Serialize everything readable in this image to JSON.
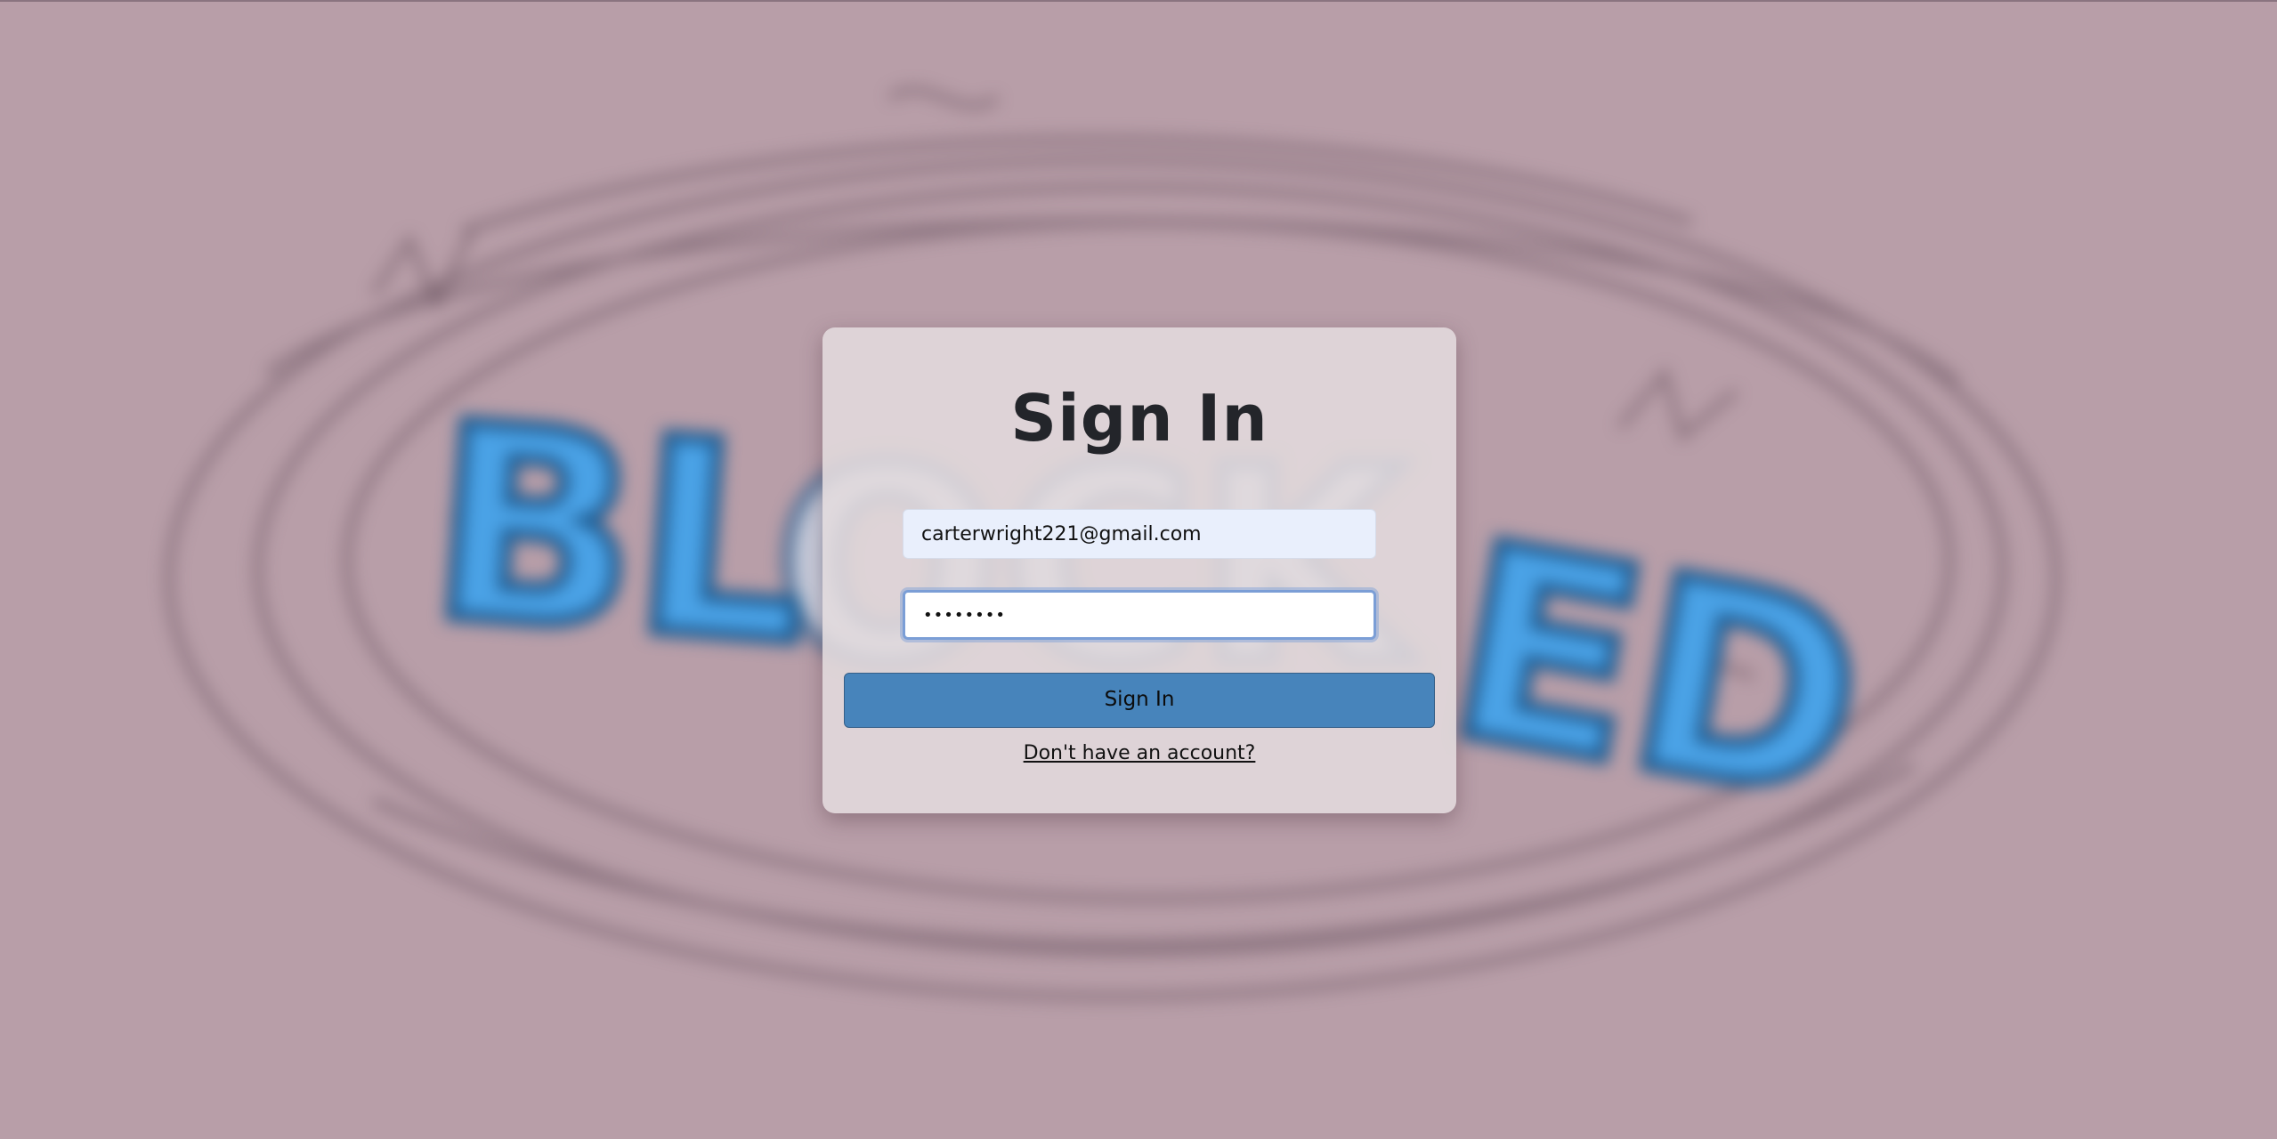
{
  "background": {
    "color": "#b89ea8",
    "artwork_label": "BLOCKED"
  },
  "login": {
    "title": "Sign In",
    "email_value": "carterwright221@gmail.com",
    "password_value": "••••••••",
    "submit_label": "Sign In",
    "signup_link": "Don't have an account?"
  },
  "colors": {
    "button": "#4784bb",
    "focus_ring": "#7b9ed6",
    "email_bg": "#e9effc"
  }
}
